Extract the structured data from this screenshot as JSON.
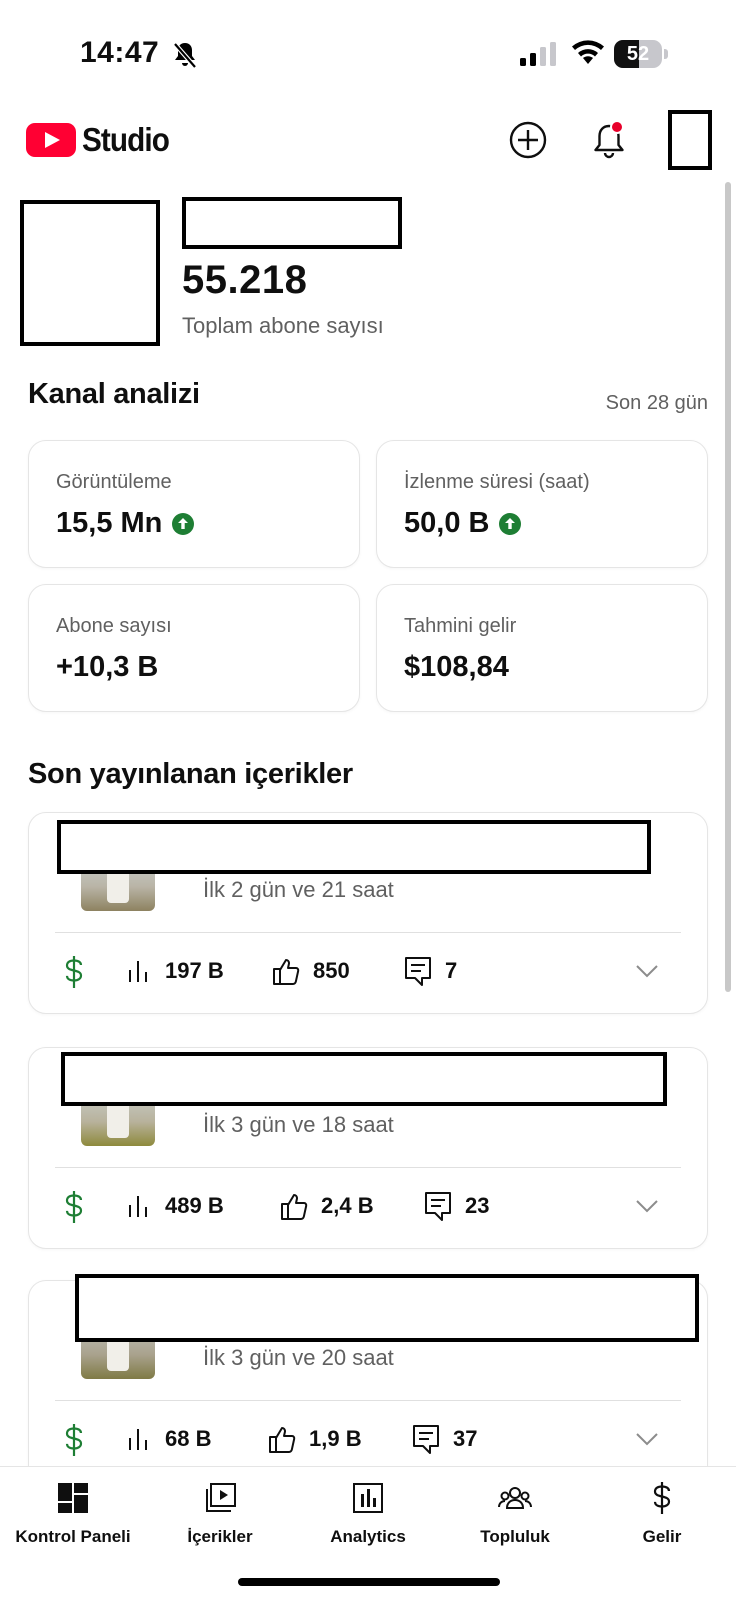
{
  "status_bar": {
    "time": "14:47",
    "battery": "52",
    "battery_level": 0.52
  },
  "header": {
    "logo_text": "Studio"
  },
  "channel": {
    "subscriber_count": "55.218",
    "subscriber_label": "Toplam abone sayısı"
  },
  "analytics": {
    "title": "Kanal analizi",
    "period": "Son 28 gün",
    "metrics": [
      {
        "label": "Görüntüleme",
        "value": "15,5 Mn",
        "trend": "up"
      },
      {
        "label": "İzlenme süresi (saat)",
        "value": "50,0 B",
        "trend": "up"
      },
      {
        "label": "Abone sayısı",
        "value": "+10,3 B"
      },
      {
        "label": "Tahmini gelir",
        "value": "$108,84"
      }
    ]
  },
  "recent": {
    "title": "Son yayınlanan içerikler",
    "items": [
      {
        "time": "İlk 2 gün ve 21 saat",
        "views": "197 B",
        "likes": "850",
        "comments": "7"
      },
      {
        "time": "İlk 3 gün ve 18 saat",
        "views": "489 B",
        "likes": "2,4 B",
        "comments": "23"
      },
      {
        "time": "İlk 3 gün ve 20 saat",
        "views": "68 B",
        "likes": "1,9 B",
        "comments": "37"
      }
    ]
  },
  "nav": {
    "items": [
      {
        "label": "Kontrol Paneli",
        "icon": "dashboard-icon"
      },
      {
        "label": "İçerikler",
        "icon": "content-icon"
      },
      {
        "label": "Analytics",
        "icon": "analytics-icon"
      },
      {
        "label": "Topluluk",
        "icon": "community-icon"
      },
      {
        "label": "Gelir",
        "icon": "earn-icon"
      }
    ]
  },
  "colors": {
    "brand": "#ff0033",
    "positive": "#1e7e34",
    "muted_text": "#606060"
  }
}
